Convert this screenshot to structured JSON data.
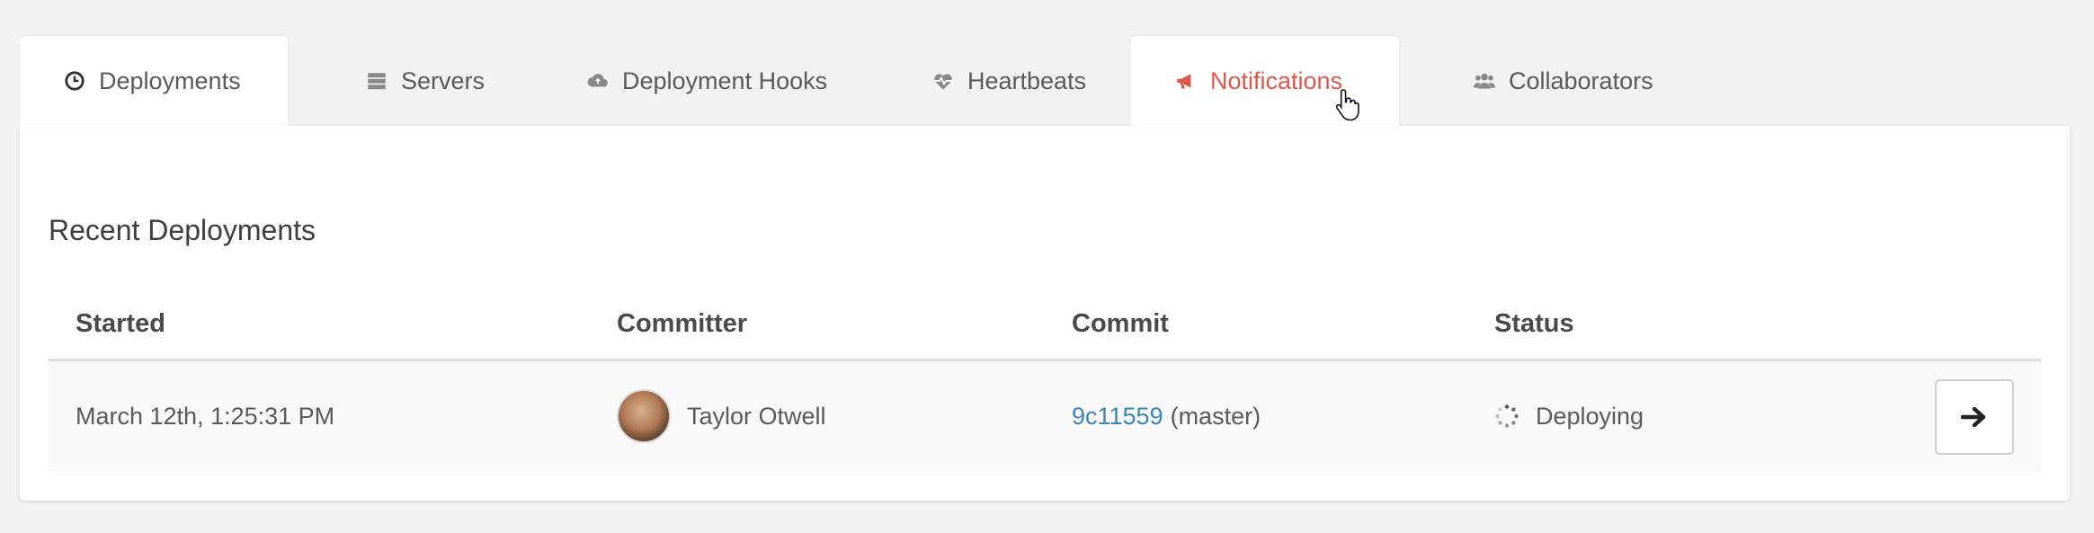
{
  "tabs": [
    {
      "label": "Deployments",
      "icon": "clock-icon"
    },
    {
      "label": "Servers",
      "icon": "server-icon"
    },
    {
      "label": "Deployment Hooks",
      "icon": "cloud-upload-icon"
    },
    {
      "label": "Heartbeats",
      "icon": "heartbeat-icon"
    },
    {
      "label": "Notifications",
      "icon": "bullhorn-icon"
    },
    {
      "label": "Collaborators",
      "icon": "users-icon"
    }
  ],
  "section": {
    "title": "Recent Deployments"
  },
  "table": {
    "headers": [
      "Started",
      "Committer",
      "Commit",
      "Status"
    ],
    "rows": [
      {
        "started": "March 12th, 1:25:31 PM",
        "committer": "Taylor Otwell",
        "commit_hash": "9c11559",
        "branch": "(master)",
        "status": "Deploying"
      }
    ]
  },
  "colors": {
    "accent": "#e2574c",
    "link": "#3a86b9"
  }
}
